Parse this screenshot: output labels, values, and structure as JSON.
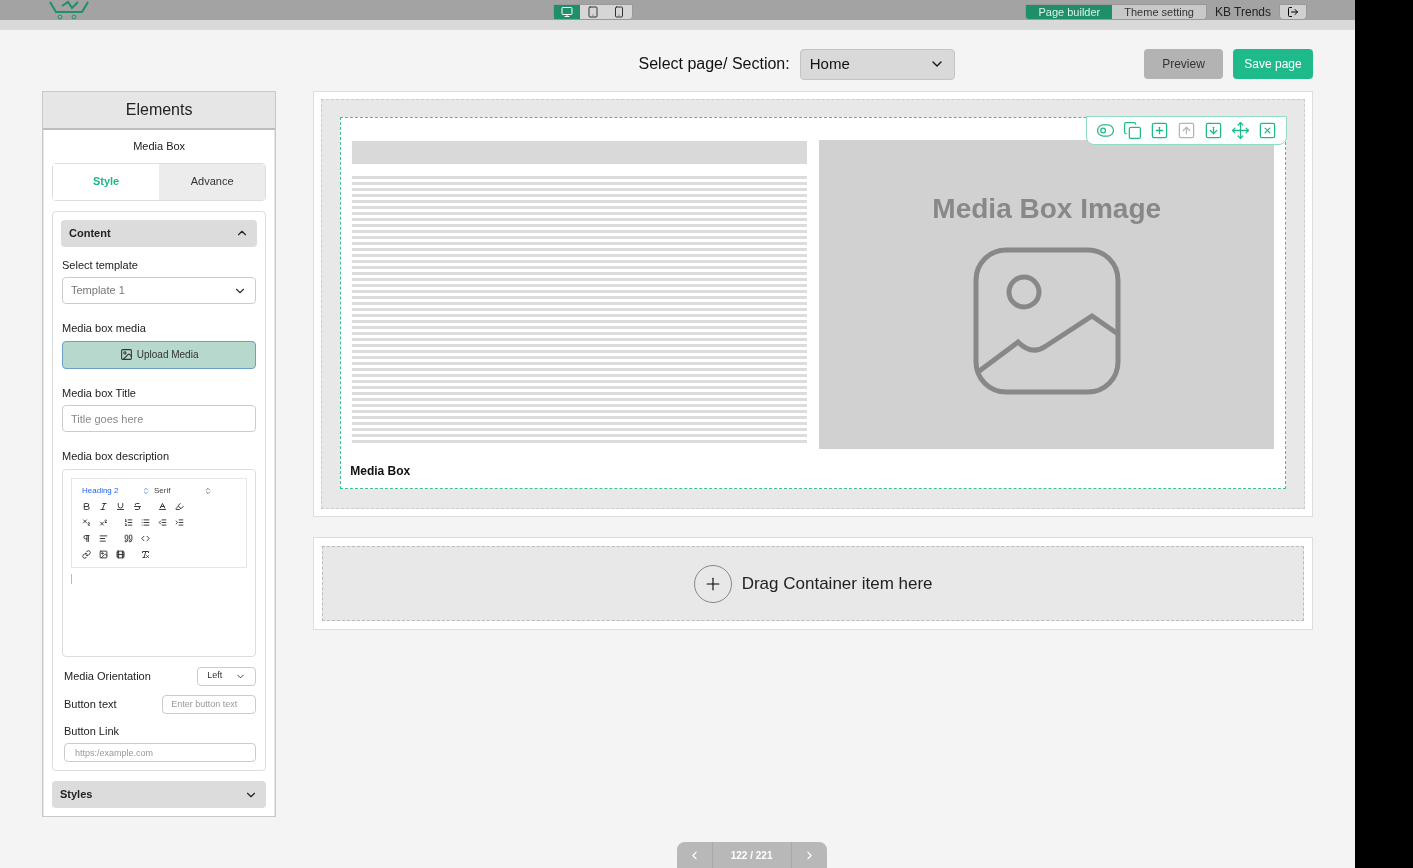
{
  "header": {
    "modes": [
      {
        "label": "Page builder",
        "selected": true
      },
      {
        "label": "Theme setting",
        "selected": false
      }
    ],
    "store": "KB Trends",
    "devices": [
      {
        "kind": "desktop",
        "selected": true
      },
      {
        "kind": "tablet",
        "selected": false
      },
      {
        "kind": "phone",
        "selected": false
      }
    ]
  },
  "page_select": {
    "label": "Select page/ Section:",
    "value": "Home"
  },
  "actions": {
    "preview": "Preview",
    "save": "Save page"
  },
  "sidebar": {
    "title": "Elements",
    "subtitle": "Media Box",
    "tabs": [
      {
        "label": "Style",
        "selected": true
      },
      {
        "label": "Advance",
        "selected": false
      }
    ],
    "content": {
      "title": "Content",
      "expanded": true,
      "template_label": "Select template",
      "template_value": "Template 1",
      "media_label": "Media box media",
      "upload": "Upload Media",
      "title_label": "Media box Title",
      "title_placeholder": "Title goes here",
      "description_label": "Media box description",
      "editor": {
        "heading": "Heading 2",
        "font": "Serif",
        "toolbar": [
          [
            {
              "kind": "bold",
              "spaced": false
            },
            {
              "kind": "italic",
              "spaced": false
            },
            {
              "kind": "underline",
              "spaced": false
            },
            {
              "kind": "strike",
              "spaced": false
            },
            {
              "kind": "color",
              "spaced": true
            },
            {
              "kind": "highlight",
              "spaced": false
            }
          ],
          [
            {
              "kind": "subscript",
              "spaced": false
            },
            {
              "kind": "superscript",
              "spaced": false
            },
            {
              "kind": "ordered",
              "spaced": true
            },
            {
              "kind": "bullet",
              "spaced": false
            },
            {
              "kind": "outdent",
              "spaced": false
            },
            {
              "kind": "indent",
              "spaced": false
            }
          ],
          [
            {
              "kind": "rtl",
              "spaced": false
            },
            {
              "kind": "align",
              "spaced": false
            },
            {
              "kind": "quote",
              "spaced": true
            },
            {
              "kind": "code",
              "spaced": false
            }
          ],
          [
            {
              "kind": "link",
              "spaced": false
            },
            {
              "kind": "image",
              "spaced": false
            },
            {
              "kind": "video",
              "spaced": false
            },
            {
              "kind": "clear",
              "spaced": true
            }
          ]
        ]
      },
      "orientation_label": "Media Orientation",
      "orientation_value": "Left",
      "button_text_label": "Button text",
      "button_text_placeholder": "Enter button text",
      "button_link_label": "Button Link",
      "button_link_placeholder": "https:/example.com"
    },
    "styles": {
      "title": "Styles",
      "expanded": false
    }
  },
  "canvas": {
    "component_toolbar": [
      {
        "kind": "toggle",
        "disabled": false
      },
      {
        "kind": "duplicate",
        "disabled": false
      },
      {
        "kind": "add",
        "disabled": false
      },
      {
        "kind": "up",
        "disabled": true
      },
      {
        "kind": "down",
        "disabled": false
      },
      {
        "kind": "move",
        "disabled": false
      },
      {
        "kind": "delete",
        "disabled": false
      }
    ],
    "image_title": "Media Box Image",
    "block_label": "Media Box",
    "drop_text": "Drag Container item here"
  },
  "pager": {
    "text": "122 / 221"
  }
}
